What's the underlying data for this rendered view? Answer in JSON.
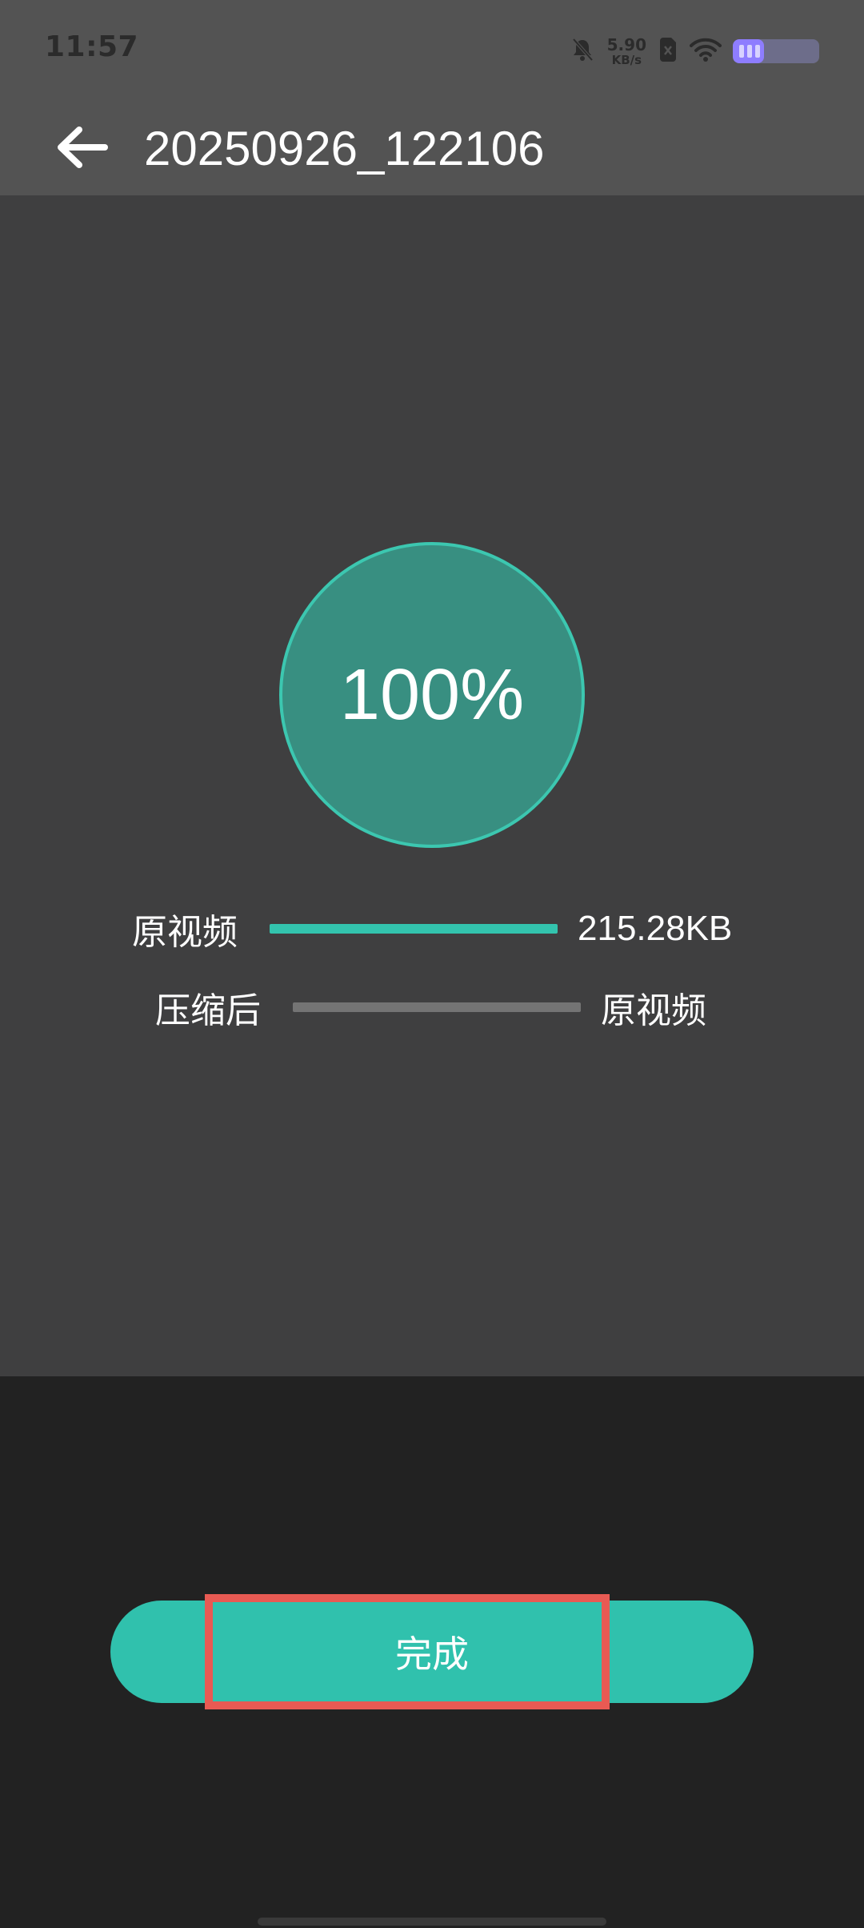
{
  "status_bar": {
    "time": "11:57",
    "net_speed_value": "5.90",
    "net_speed_unit": "KB/s",
    "battery_level_percent": 36
  },
  "toolbar": {
    "back_icon": "arrow-left-icon",
    "title": "20250926_122106"
  },
  "progress": {
    "percent_text": "100%"
  },
  "comparison": {
    "original_label": "原视频",
    "original_value": "215.28KB",
    "compressed_label": "压缩后",
    "compressed_value": "原视频"
  },
  "actions": {
    "done_label": "完成"
  },
  "colors": {
    "accent": "#30c1ad",
    "circle_fill": "#388f81",
    "highlight": "#e85a53"
  }
}
